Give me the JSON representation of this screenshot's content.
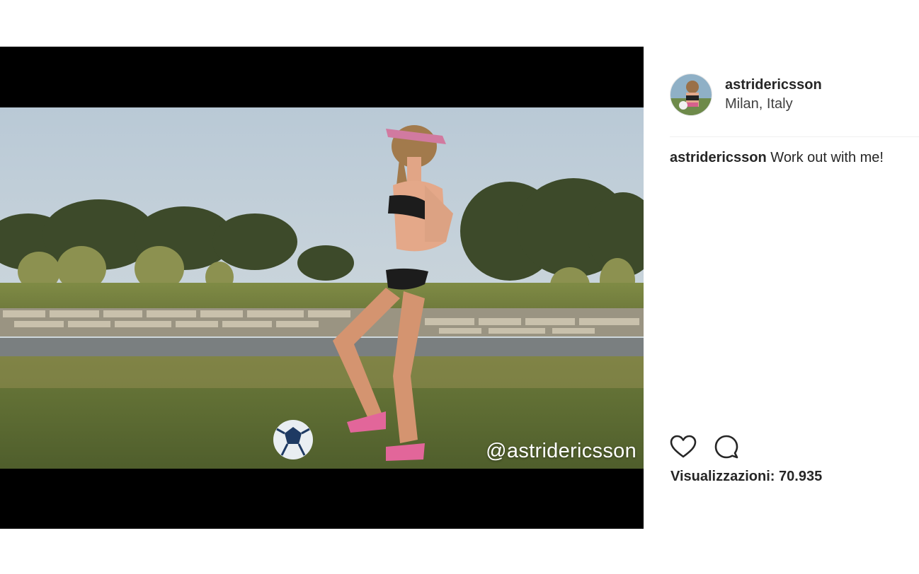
{
  "post": {
    "username": "astridericsson",
    "location": "Milan, Italy",
    "caption_user": "astridericsson",
    "caption_text": "Work out with me!",
    "views_label": "Visualizzazioni:",
    "views_count": "70.935"
  },
  "video": {
    "watermark": "@astridericsson"
  },
  "icons": {
    "like": "heart-icon",
    "comment": "comment-icon"
  },
  "colors": {
    "text": "#262626",
    "divider": "#efefef",
    "letterbox": "#000000"
  }
}
